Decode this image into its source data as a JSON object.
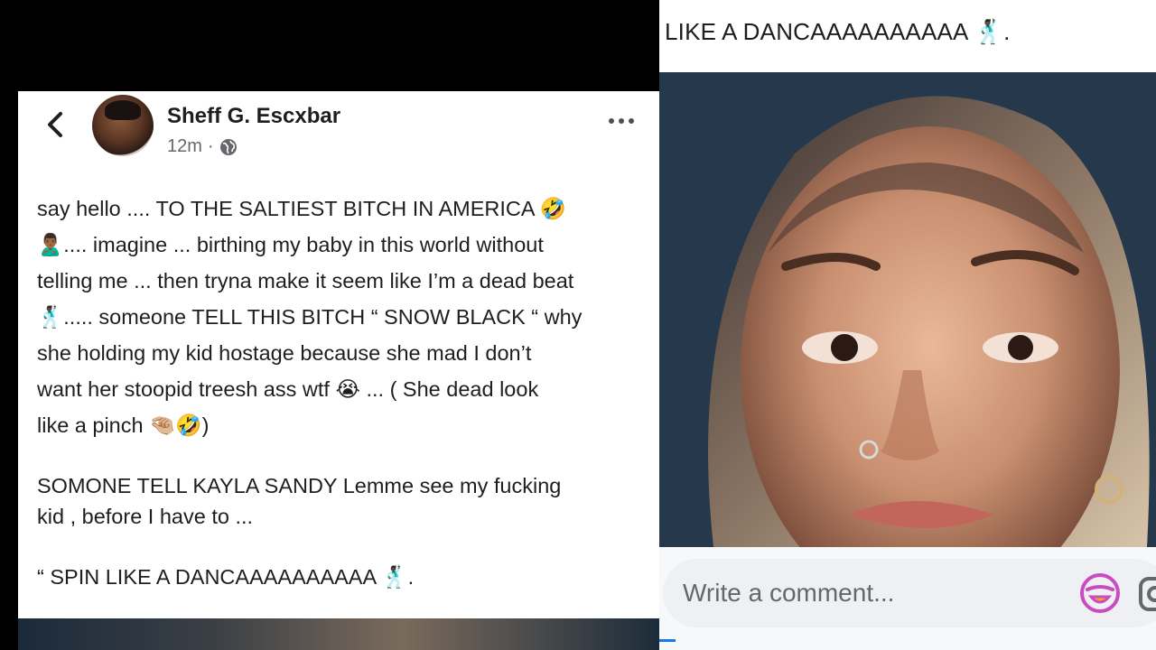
{
  "post": {
    "author": "Sheff G. Escxbar",
    "time": "12m",
    "separator": "·",
    "body_lines": [
      "say hello .... TO THE SALTIEST BITCH IN AMERICA 🤣",
      "🙎🏾‍♂️.... imagine ... birthing my baby in this world without",
      "telling me ... then tryna make it seem like I’m a dead beat",
      "🕺🏿.....  someone TELL THIS BITCH “ SNOW BLACK “ why",
      "she holding my kid hostage because she mad I don’t",
      "want her stoopid treesh ass wtf 😭 ...  ( She dead look",
      "like a pinch 🤏🏼🤣)"
    ],
    "body_lines_2": [
      "SOMONE TELL KAYLA SANDY Lemme see my fucking",
      "kid , before I have to ..."
    ],
    "body_line_3": "“ SPIN LIKE A DANCAAAAAAAAAA 🕺🏿."
  },
  "right": {
    "caption": "LIKE A DANCAAAAAAAAAA 🕺🏿.",
    "comment_placeholder": "Write a comment..."
  },
  "icons": {
    "back": "chevron-left-icon",
    "privacy": "globe-icon",
    "more": "more-options-icon",
    "sticker": "sticker-icon",
    "camera": "camera-icon"
  },
  "colors": {
    "accent": "#1877f2",
    "sticker_accent": "#c94cc0"
  }
}
